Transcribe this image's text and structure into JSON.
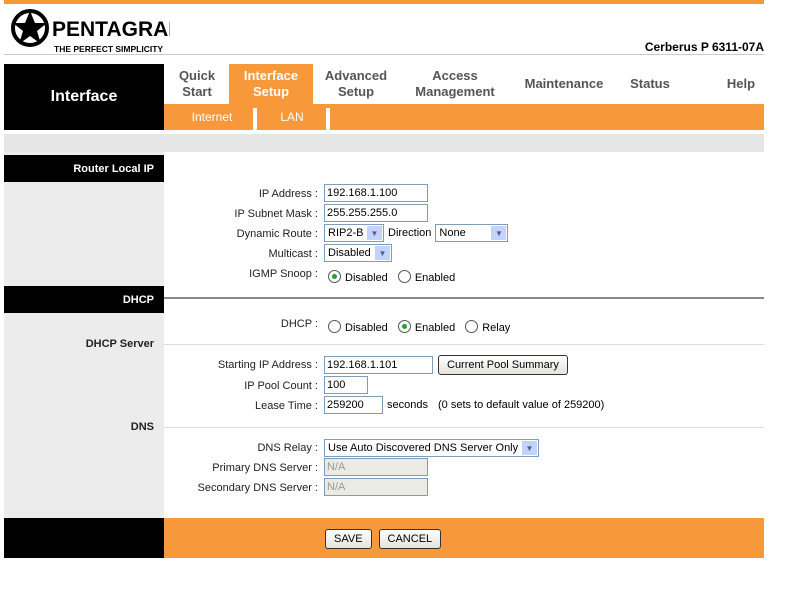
{
  "header": {
    "logo_text": "PENTAGRAM",
    "logo_tagline": "THE PERFECT SIMPLICITY",
    "model": "Cerberus P 6311-07A"
  },
  "nav": {
    "section": "Interface",
    "tabs": [
      {
        "label": "Quick Start"
      },
      {
        "label": "Interface Setup"
      },
      {
        "label": "Advanced Setup"
      },
      {
        "label": "Access Management"
      },
      {
        "label": "Maintenance"
      },
      {
        "label": "Status"
      },
      {
        "label": "Help"
      }
    ],
    "subtabs": [
      "Internet",
      "LAN"
    ]
  },
  "sections": {
    "router_local_ip": "Router Local IP",
    "dhcp": "DHCP",
    "dhcp_server": "DHCP Server",
    "dns": "DNS"
  },
  "lan": {
    "ip_label": "IP Address",
    "ip": "192.168.1.100",
    "mask_label": "IP Subnet Mask",
    "mask": "255.255.255.0",
    "route_label": "Dynamic Route",
    "route": "RIP2-B",
    "direction_label": "Direction",
    "direction": "None",
    "multicast_label": "Multicast",
    "multicast": "Disabled",
    "igmp_label": "IGMP Snoop",
    "igmp_options": [
      "Disabled",
      "Enabled"
    ],
    "igmp_selected": "Disabled"
  },
  "dhcp": {
    "label": "DHCP",
    "options": [
      "Disabled",
      "Enabled",
      "Relay"
    ],
    "selected": "Enabled",
    "start_label": "Starting IP Address",
    "start": "192.168.1.101",
    "pool_button": "Current Pool Summary",
    "count_label": "IP Pool Count",
    "count": "100",
    "lease_label": "Lease Time",
    "lease": "259200",
    "lease_unit": "seconds",
    "lease_note": "(0 sets to default value of 259200)"
  },
  "dns": {
    "relay_label": "DNS Relay",
    "relay": "Use Auto Discovered DNS Server Only",
    "primary_label": "Primary DNS Server",
    "primary": "N/A",
    "secondary_label": "Secondary DNS Server",
    "secondary": "N/A"
  },
  "footer": {
    "save": "SAVE",
    "cancel": "CANCEL"
  }
}
